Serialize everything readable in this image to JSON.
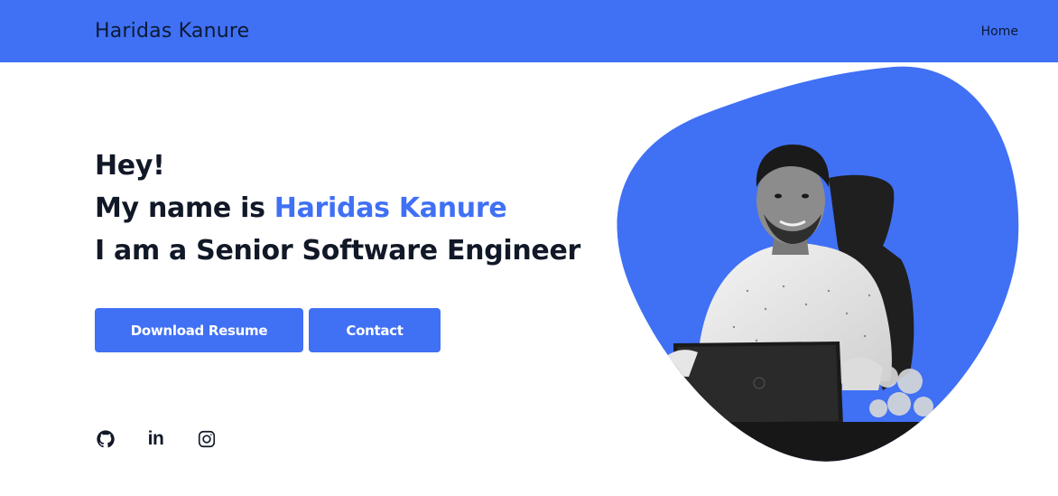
{
  "nav": {
    "brand": "Haridas Kanure",
    "links": [
      "Home"
    ]
  },
  "hero": {
    "greeting": "Hey!",
    "name_prefix": "My name is ",
    "name": "Haridas Kanure",
    "role": "I am a Senior Software Engineer"
  },
  "buttons": {
    "resume": "Download Resume",
    "contact": "Contact"
  },
  "socials": {
    "github": "github-icon",
    "linkedin": "in",
    "instagram": "instagram-icon"
  },
  "colors": {
    "accent": "#4070f4",
    "text": "#111827",
    "background": "#ffffff"
  }
}
